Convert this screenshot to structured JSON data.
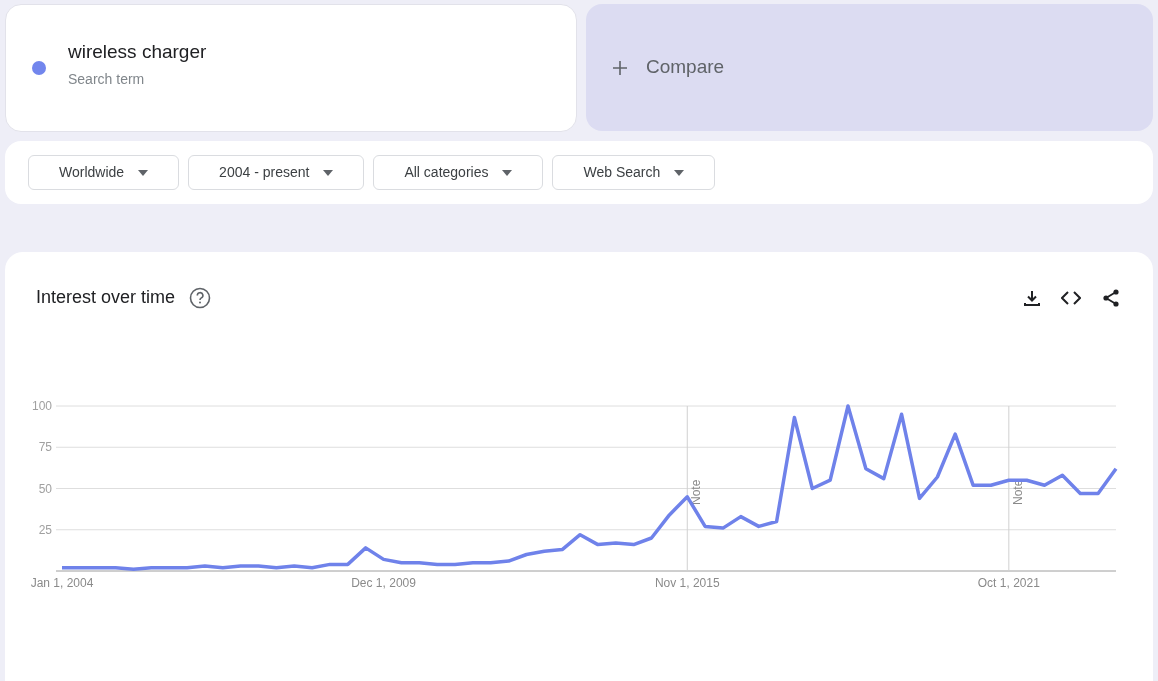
{
  "search_term": {
    "label": "wireless charger",
    "sublabel": "Search term",
    "color": "#7286ed"
  },
  "compare": {
    "label": "Compare"
  },
  "filters": [
    {
      "label": "Worldwide"
    },
    {
      "label": "2004 - present"
    },
    {
      "label": "All categories"
    },
    {
      "label": "Web Search"
    }
  ],
  "interest_over_time": {
    "title": "Interest over time",
    "chart_data": {
      "type": "line",
      "grid": true,
      "categories": [
        "Jan 1, 2004",
        null,
        null,
        null,
        null,
        null,
        null,
        null,
        null,
        null,
        null,
        null,
        null,
        null,
        null,
        null,
        null,
        null,
        "Dec 1, 2009",
        null,
        null,
        null,
        null,
        null,
        null,
        null,
        null,
        null,
        null,
        null,
        null,
        null,
        null,
        null,
        null,
        "Nov 1, 2015",
        null,
        null,
        null,
        null,
        null,
        null,
        null,
        null,
        null,
        null,
        null,
        null,
        null,
        null,
        null,
        null,
        null,
        "Oct 1, 2021",
        null,
        null,
        null,
        null,
        null,
        null
      ],
      "ylim": [
        0,
        100
      ],
      "yticks": [
        25,
        50,
        75,
        100
      ],
      "series": [
        {
          "color": "#6f82ea",
          "values": [
            2,
            2,
            2,
            2,
            1,
            2,
            2,
            2,
            3,
            2,
            3,
            3,
            2,
            3,
            2,
            4,
            4,
            14,
            7,
            5,
            5,
            4,
            4,
            5,
            5,
            6,
            10,
            12,
            13,
            22,
            16,
            17,
            16,
            20,
            34,
            45,
            27,
            26,
            33,
            27,
            30,
            93,
            50,
            55,
            100,
            62,
            56,
            95,
            44,
            57,
            83,
            52,
            52,
            55,
            55,
            52,
            58,
            47,
            47,
            62
          ]
        }
      ],
      "annotations": [
        "Note",
        "Note"
      ]
    }
  }
}
